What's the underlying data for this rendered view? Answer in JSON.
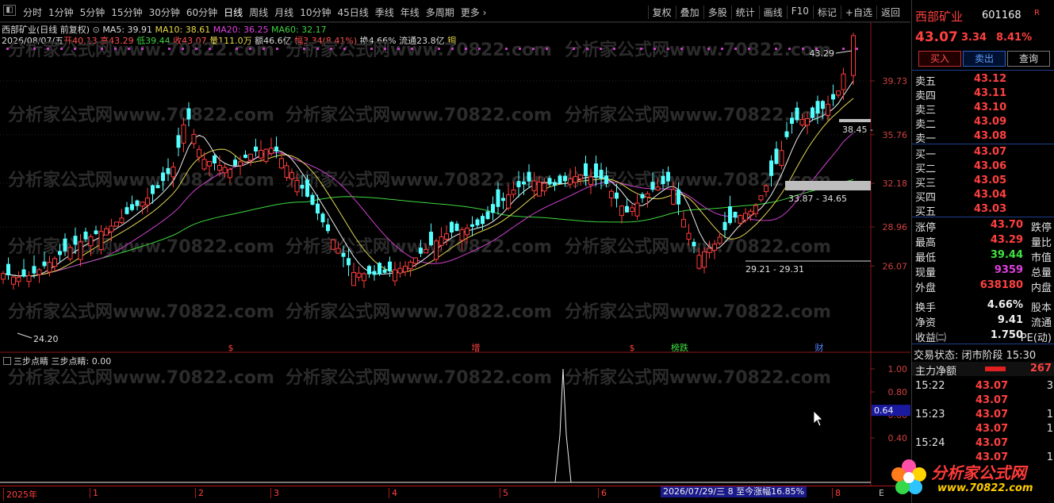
{
  "toolbar": {
    "periods": [
      "分时",
      "1分钟",
      "5分钟",
      "15分钟",
      "30分钟",
      "60分钟",
      "日线",
      "周线",
      "月线",
      "10分钟",
      "45日线",
      "季线",
      "年线",
      "多周期",
      "更多 ›"
    ],
    "active_period": "日线",
    "tools": [
      "复权",
      "叠加",
      "多股",
      "统计",
      "画线",
      "F10",
      "标记",
      "+自选",
      "返回"
    ]
  },
  "info": {
    "title": "西部矿业(日线 前复权)",
    "ma5": "MA5: 39.91",
    "ma10": "MA10: 38.61",
    "ma20": "MA20: 36.25",
    "ma60": "MA60: 32.17",
    "date": "2026/08/07/五",
    "open": "开40.13",
    "high": "高43.29",
    "low": "低39.44",
    "close": "收43.07",
    "volume": "量111.0万",
    "amount": "额46.6亿",
    "range": "幅3.34(8.41%)",
    "turnover": "换4.66%",
    "float": "流通23.8亿",
    "sector": "铜"
  },
  "watermark": "分析家公式网www.70822.com",
  "main_chart": {
    "price_axis": [
      "39.73",
      "35.76",
      "32.18",
      "28.96",
      "26.07"
    ],
    "annotations": {
      "high": "43.29",
      "low": "24.20",
      "zone1": "38.45 -",
      "zone2": "33.87 - 34.65",
      "zone3": "29.21 - 29.31"
    },
    "event_marks": [
      "$",
      "增",
      "$",
      "榜跌",
      "财"
    ]
  },
  "sub_chart": {
    "label": "三步点睛 三步点睛: 0.00",
    "axis": [
      "1.00",
      "0.80",
      "0.60",
      "0.40"
    ],
    "cursor_value": "0.64"
  },
  "date_axis": {
    "labels": [
      "2025年",
      "1",
      "2",
      "3",
      "4",
      "5",
      "6",
      "7",
      "8"
    ],
    "range_text": "2026/07/29/三  8 至今涨幅16.85%",
    "end_label": "E"
  },
  "panel": {
    "name": "西部矿业",
    "code": "601168",
    "code_flag": "R",
    "price": "43.07",
    "change": "3.34",
    "pct": "8.41%",
    "buttons": {
      "buy": "买入",
      "sell": "卖出",
      "query": "查询"
    },
    "asks": [
      {
        "label": "卖五",
        "price": "43.12"
      },
      {
        "label": "卖四",
        "price": "43.11"
      },
      {
        "label": "卖三",
        "price": "43.10"
      },
      {
        "label": "卖二",
        "price": "43.09"
      },
      {
        "label": "卖一",
        "price": "43.08"
      }
    ],
    "bids": [
      {
        "label": "买一",
        "price": "43.07"
      },
      {
        "label": "买二",
        "price": "43.06"
      },
      {
        "label": "买三",
        "price": "43.05"
      },
      {
        "label": "买四",
        "price": "43.04"
      },
      {
        "label": "买五",
        "price": "43.03"
      }
    ],
    "stats": [
      {
        "k1": "涨停",
        "v1": "43.70",
        "k2": "跌停",
        "color": "#ff4040"
      },
      {
        "k1": "最高",
        "v1": "43.29",
        "k2": "量比",
        "color": "#ff4040"
      },
      {
        "k1": "最低",
        "v1": "39.44",
        "k2": "市值",
        "color": "#40e040"
      },
      {
        "k1": "现量",
        "v1": "9359",
        "k2": "总量",
        "color": "#e040e0"
      },
      {
        "k1": "外盘",
        "v1": "638180",
        "k2": "内盘",
        "color": "#ff4040"
      },
      {
        "k1": "换手",
        "v1": "4.66%",
        "k2": "股本",
        "color": "#f0f0f0"
      },
      {
        "k1": "净资",
        "v1": "9.41",
        "k2": "流通",
        "color": "#f0f0f0"
      },
      {
        "k1": "收益㈡",
        "v1": "1.750",
        "k2": "PE(动)",
        "color": "#f0f0f0"
      }
    ],
    "status": "交易状态: 闭市阶段 15:30",
    "flow_label": "主力净额",
    "flow_value": "267",
    "ticks": [
      {
        "time": "15:22",
        "price": "43.07",
        "qty": "3"
      },
      {
        "time": "",
        "price": "43.07",
        "qty": ""
      },
      {
        "time": "15:23",
        "price": "43.07",
        "qty": "1"
      },
      {
        "time": "",
        "price": "43.07",
        "qty": "1"
      },
      {
        "time": "15:24",
        "price": "43.07",
        "qty": ""
      },
      {
        "time": "",
        "price": "43.07",
        "qty": "1"
      }
    ]
  },
  "logo": {
    "name": "分析家公式网",
    "url": "www.70822.com"
  }
}
